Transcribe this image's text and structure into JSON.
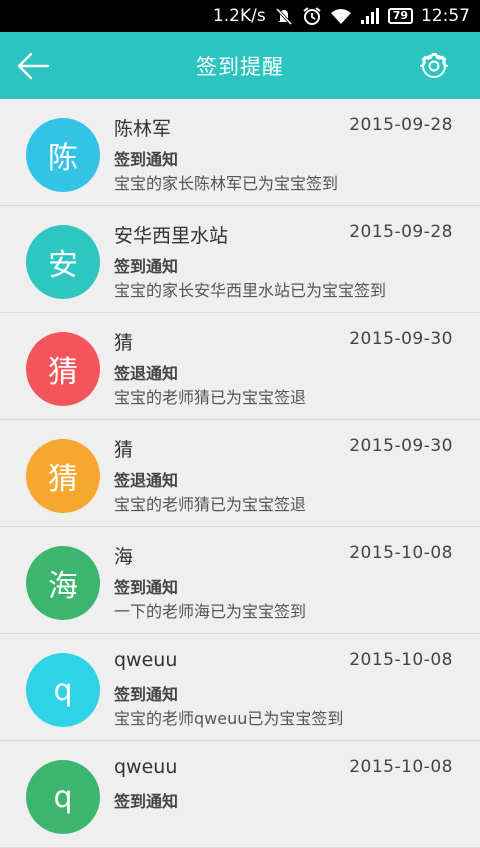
{
  "status_bar": {
    "speed": "1.2K/s",
    "battery": "79",
    "time": "12:57"
  },
  "header": {
    "title": "签到提醒",
    "back_icon": "back-arrow-icon",
    "settings_icon": "gear-icon",
    "background": "#2bc4c0"
  },
  "items": [
    {
      "avatar": "陈",
      "color": "#33c3e6",
      "name": "陈林军",
      "date": "2015-09-28",
      "type": "签到通知",
      "message": "宝宝的家长陈林军已为宝宝签到"
    },
    {
      "avatar": "安",
      "color": "#2ec7c0",
      "name": "安华西里水站",
      "date": "2015-09-28",
      "type": "签到通知",
      "message": "宝宝的家长安华西里水站已为宝宝签到"
    },
    {
      "avatar": "猜",
      "color": "#f4555a",
      "name": "猜",
      "date": "2015-09-30",
      "type": "签退通知",
      "message": "宝宝的老师猜已为宝宝签退"
    },
    {
      "avatar": "猜",
      "color": "#f5a72e",
      "name": "猜",
      "date": "2015-09-30",
      "type": "签退通知",
      "message": "宝宝的老师猜已为宝宝签退"
    },
    {
      "avatar": "海",
      "color": "#3cb66e",
      "name": "海",
      "date": "2015-10-08",
      "type": "签到通知",
      "message": "一下的老师海已为宝宝签到"
    },
    {
      "avatar": "q",
      "color": "#2fd3e6",
      "name": "qweuu",
      "date": "2015-10-08",
      "type": "签到通知",
      "message": "宝宝的老师qweuu已为宝宝签到"
    },
    {
      "avatar": "q",
      "color": "#3cb66e",
      "name": "qweuu",
      "date": "2015-10-08",
      "type": "签到通知",
      "message": ""
    }
  ]
}
